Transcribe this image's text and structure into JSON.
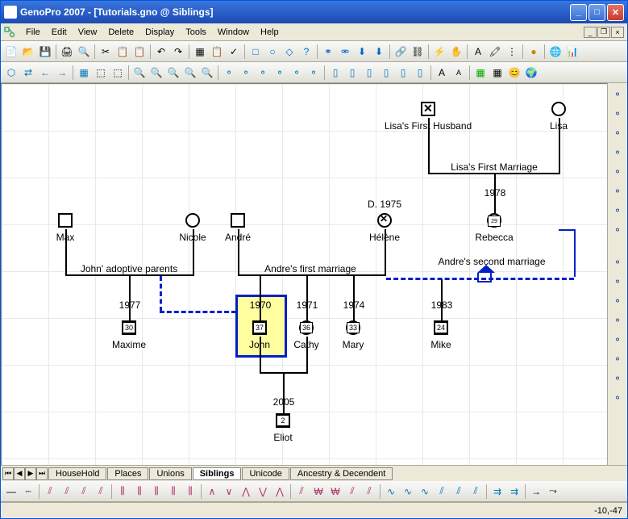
{
  "app_title": "GenoPro 2007 - [Tutorials.gno @ Siblings]",
  "menu": [
    "File",
    "Edit",
    "View",
    "Delete",
    "Display",
    "Tools",
    "Window",
    "Help"
  ],
  "tabs": [
    "HouseHold",
    "Places",
    "Unions",
    "Siblings",
    "Unicode",
    "Ancestry & Decendent"
  ],
  "active_tab": "Siblings",
  "status_coords": "-10,-47",
  "people": {
    "lisa_husband": "Lisa's First Husband",
    "lisa": "Lisa",
    "max": "Max",
    "nicole": "Nicole",
    "andre": "André",
    "helene": "Hélène",
    "helene_death": "D. 1975",
    "rebecca": "Rebecca",
    "rebecca_age": "29",
    "maxime": "Maxime",
    "maxime_year": "1977",
    "maxime_age": "30",
    "john": "John",
    "john_year": "1970",
    "john_age": "37",
    "cathy": "Cathy",
    "cathy_year": "1971",
    "cathy_age": "36",
    "mary": "Mary",
    "mary_year": "1974",
    "mary_age": "33",
    "mike": "Mike",
    "mike_year": "1983",
    "mike_age": "24",
    "eliot": "Eliot",
    "eliot_year": "2005",
    "eliot_age": "2"
  },
  "marriages": {
    "lisa_first": "Lisa's First Marriage",
    "lisa_first_year": "1978",
    "john_adoptive": "John' adoptive parents",
    "andre_first": "Andre's first marriage",
    "andre_second": "Andre's second marriage"
  }
}
